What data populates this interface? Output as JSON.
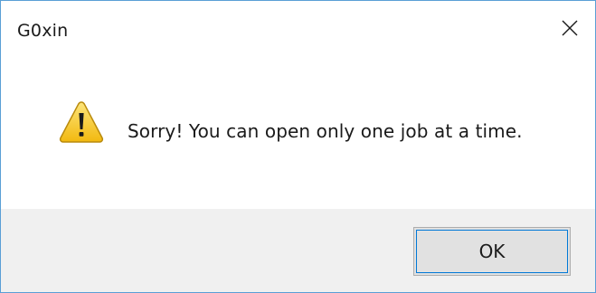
{
  "window": {
    "title": "G0xin"
  },
  "message": {
    "icon": "warning-icon",
    "text": "Sorry! You can open only one job at a time."
  },
  "buttons": {
    "ok_label": "OK"
  },
  "colors": {
    "window_border": "#5a9fd6",
    "footer_background": "#f0f0f0",
    "button_background": "#e1e1e1",
    "button_focus": "#0078d7",
    "warning_yellow": "#f5c518"
  }
}
